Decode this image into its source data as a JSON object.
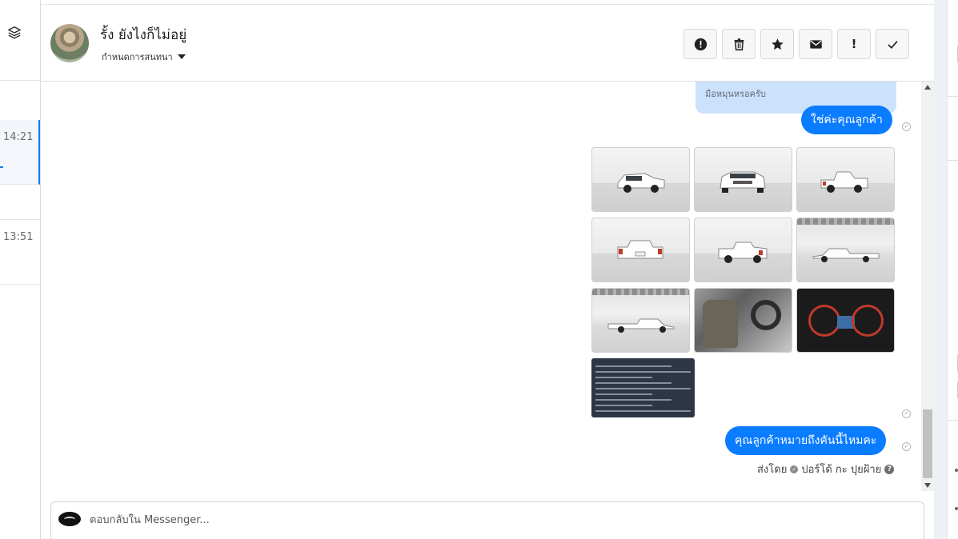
{
  "contact": {
    "name": "รั้ง ยังไงก็ไม่อยู่",
    "assign_label": "กำหนดการสนทนา"
  },
  "conversations": [
    {
      "time": "14:21"
    },
    {
      "time": "13:51"
    }
  ],
  "header_actions": [
    {
      "name": "report",
      "icon": "alert-circle-icon"
    },
    {
      "name": "delete",
      "icon": "trash-icon"
    },
    {
      "name": "star",
      "icon": "star-icon"
    },
    {
      "name": "mark-unread",
      "icon": "envelope-icon",
      "label": ""
    },
    {
      "name": "important",
      "icon": "exclamation-icon",
      "label": "!"
    },
    {
      "name": "done",
      "icon": "check-icon"
    }
  ],
  "messages": {
    "quoted_text": "มือหมุนหรอครับ",
    "reply1": "ใช่ค่ะคุณลูกค้า",
    "reply2": "คุณลูกค้าหมายถึงคันนี้ไหมคะ",
    "sent_by_label": "ส่งโดย",
    "sender_name": "ปอร์โด้ กะ ปุยฝ้าย",
    "photo_count": 10
  },
  "reply_box": {
    "placeholder": "ตอบกลับใน Messenger..."
  },
  "colors": {
    "accent": "#0a7cff",
    "quote_bg": "#cce1fb",
    "selected_row_border": "#1877f2"
  }
}
